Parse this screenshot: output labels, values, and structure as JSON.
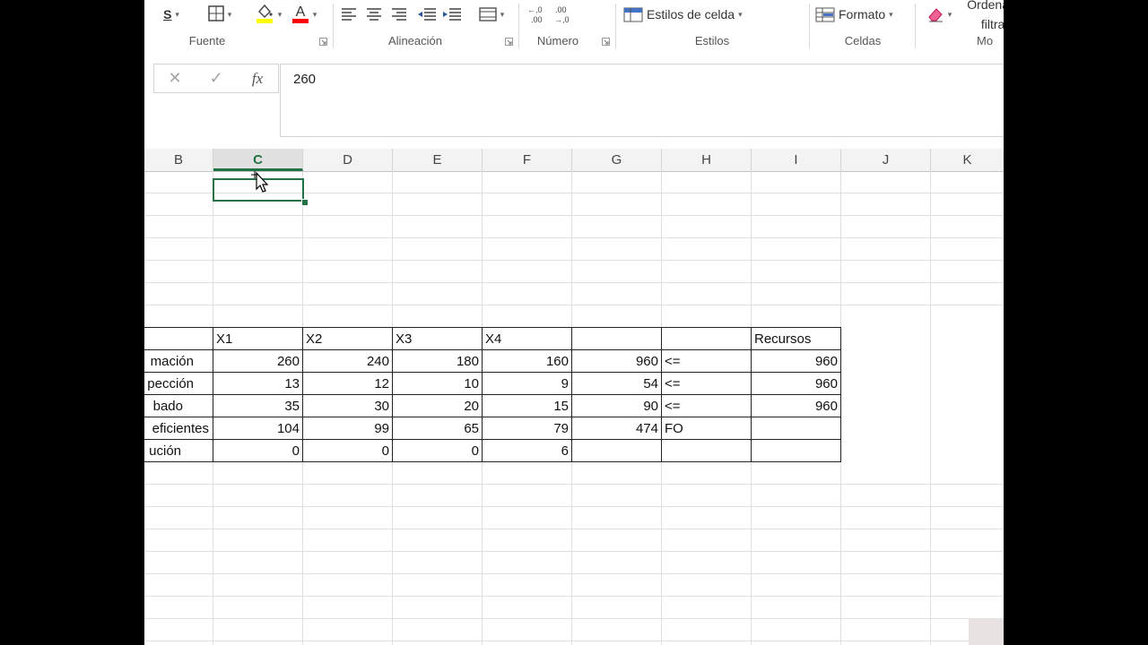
{
  "ribbon": {
    "font_group": "Fuente",
    "align_group": "Alineación",
    "number_group": "Número",
    "styles_group": "Estilos",
    "cells_group": "Celdas",
    "modify_group": "Mo",
    "underline_label": "S",
    "cell_styles_label": "Estilos de celda",
    "format_label": "Formato",
    "sort_line1": "Ordena",
    "sort_line2": "filtrar",
    "dec_increase": ",0 .00",
    "dec_decrease": ".00 ,0"
  },
  "formula_bar": {
    "cancel": "✕",
    "enter": "✓",
    "fx": "fx",
    "value": "260"
  },
  "columns": [
    "B",
    "C",
    "D",
    "E",
    "F",
    "G",
    "H",
    "I",
    "J",
    "K"
  ],
  "selected_column": "C",
  "table": {
    "header": {
      "c": "X1",
      "d": "X2",
      "e": "X3",
      "f": "X4",
      "i": "Recursos"
    },
    "rows": [
      {
        "label": "mación",
        "c": "260",
        "d": "240",
        "e": "180",
        "f": "160",
        "g": "960",
        "h": "<=",
        "i": "960"
      },
      {
        "label": "pección",
        "c": "13",
        "d": "12",
        "e": "10",
        "f": "9",
        "g": "54",
        "h": "<=",
        "i": "960"
      },
      {
        "label": "bado",
        "c": "35",
        "d": "30",
        "e": "20",
        "f": "15",
        "g": "90",
        "h": "<=",
        "i": "960"
      },
      {
        "label": "eficientes",
        "c": "104",
        "d": "99",
        "e": "65",
        "f": "79",
        "g": "474",
        "h": "FO",
        "i": ""
      },
      {
        "label": "ución",
        "c": "0",
        "d": "0",
        "e": "0",
        "f": "6",
        "g": "",
        "h": "",
        "i": ""
      }
    ]
  },
  "colors": {
    "accent": "#217346",
    "font_highlight": "#ffff00",
    "font_color": "#ff0000"
  }
}
